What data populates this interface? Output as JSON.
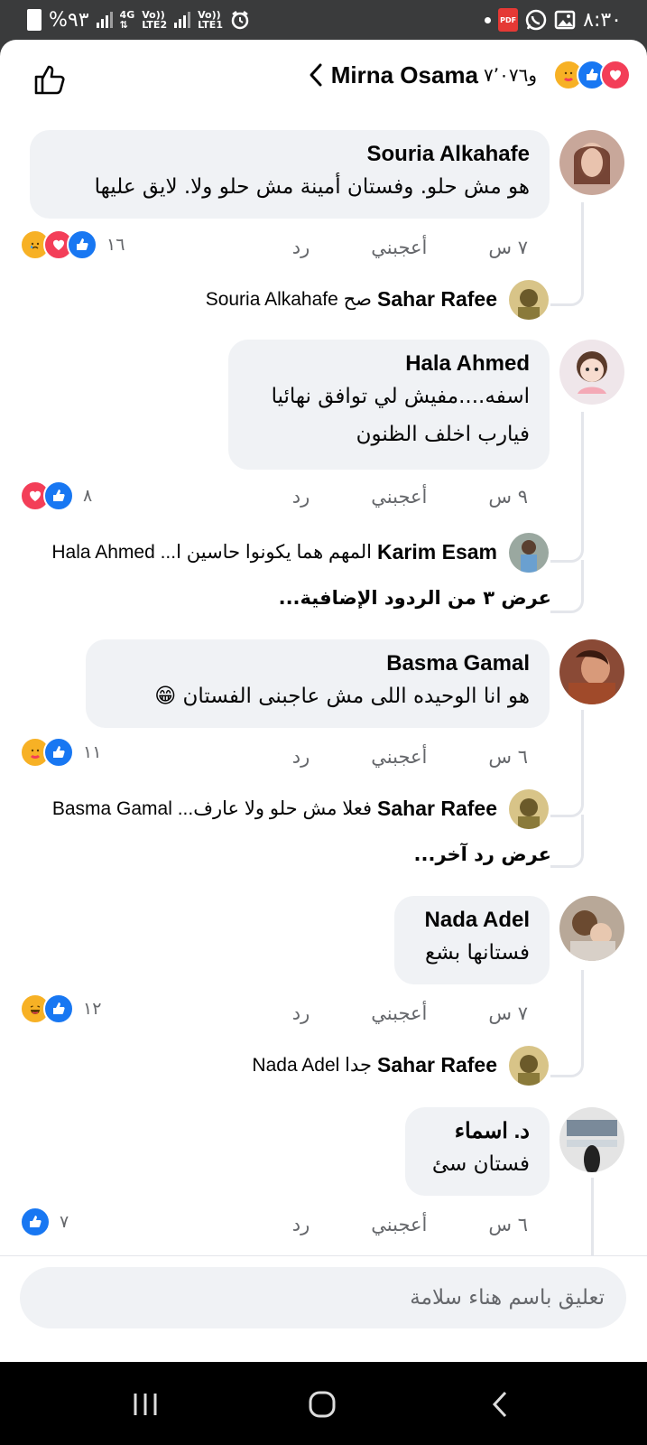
{
  "status_bar": {
    "battery": "%٩٣",
    "network1": "4G",
    "lte2": "LTE2",
    "lte1": "LTE1",
    "volte": "Vo))",
    "pdf_badge": "PDF",
    "time": "٨:٣٠"
  },
  "header": {
    "reaction_count": "و٧٬٠٧٦",
    "post_author": "Mirna Osama",
    "reactions": [
      "love",
      "like",
      "care"
    ]
  },
  "comments": [
    {
      "author": "Souria Alkahafe",
      "text_lines": [
        "هو مش حلو. وفستان أمينة مش حلو ولا. لايق عليها"
      ],
      "time": "٧ س",
      "like_label": "أعجبني",
      "reply_label": "رد",
      "reaction_count": "١٦",
      "reactions": [
        "like",
        "love",
        "sad"
      ],
      "reply": {
        "author": "Sahar Rafee",
        "text": "صح Souria Alkahafe"
      }
    },
    {
      "author": "Hala Ahmed",
      "text_lines": [
        "اسفه....مفيش لي توافق نهائيا",
        "فيارب اخلف الظنون"
      ],
      "time": "٩ س",
      "like_label": "أعجبني",
      "reply_label": "رد",
      "reaction_count": "٨",
      "reactions": [
        "like",
        "love"
      ],
      "reply": {
        "author": "Karim Esam",
        "text": "المهم هما يكونوا حاسين ا... Hala Ahmed"
      },
      "more_replies": "عرض ٣ من الردود الإضافية..."
    },
    {
      "author": "Basma Gamal",
      "text_lines": [
        "هو انا الوحيده اللى مش عاجبنى الفستان 😁"
      ],
      "time": "٦ س",
      "like_label": "أعجبني",
      "reply_label": "رد",
      "reaction_count": "١١",
      "reactions": [
        "like",
        "care"
      ],
      "reply": {
        "author": "Sahar Rafee",
        "text": "فعلا مش حلو ولا عارف... Basma Gamal"
      },
      "more_replies": "عرض رد آخر..."
    },
    {
      "author": "Nada Adel",
      "text_lines": [
        "فستانها بشع"
      ],
      "time": "٧ س",
      "like_label": "أعجبني",
      "reply_label": "رد",
      "reaction_count": "١٢",
      "reactions": [
        "like",
        "haha"
      ],
      "reply": {
        "author": "Sahar Rafee",
        "text": "جدا Nada Adel"
      }
    },
    {
      "author": "د. اسماء",
      "text_lines": [
        "فستان سئ"
      ],
      "time": "٦ س",
      "like_label": "أعجبني",
      "reply_label": "رد",
      "reaction_count": "٧",
      "reactions": [
        "like"
      ]
    }
  ],
  "composer": {
    "placeholder": "تعليق باسم هناء سلامة"
  },
  "colors": {
    "like_blue": "#1877f2",
    "love_red": "#f33e58",
    "bubble_bg": "#f0f2f5",
    "meta_gray": "#65676b"
  }
}
